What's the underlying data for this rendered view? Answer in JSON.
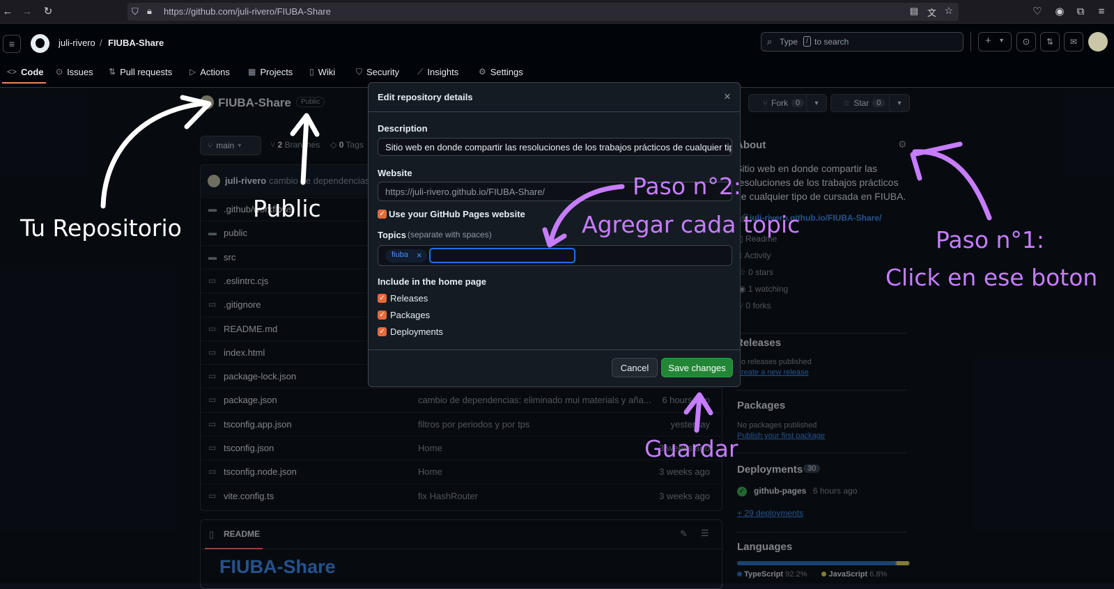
{
  "browser": {
    "url": "https://github.com/juli-rivero/FIUBA-Share"
  },
  "header": {
    "owner": "juli-rivero",
    "separator": "/",
    "repo": "FIUBA-Share",
    "search_placeholder_pre": "Type",
    "search_key": "/",
    "search_placeholder_post": "to search",
    "plus": "+"
  },
  "nav": {
    "tabs": [
      {
        "label": "Code",
        "icon": "code-icon"
      },
      {
        "label": "Issues",
        "icon": "issue-icon"
      },
      {
        "label": "Pull requests",
        "icon": "pull-request-icon"
      },
      {
        "label": "Actions",
        "icon": "play-icon"
      },
      {
        "label": "Projects",
        "icon": "table-icon"
      },
      {
        "label": "Wiki",
        "icon": "book-icon"
      },
      {
        "label": "Security",
        "icon": "shield-icon"
      },
      {
        "label": "Insights",
        "icon": "graph-icon"
      },
      {
        "label": "Settings",
        "icon": "gear-icon"
      }
    ]
  },
  "repo": {
    "name": "FIUBA-Share",
    "visibility": "Public",
    "branch": "main",
    "branches_count": "2",
    "branches_label": "Branches",
    "tags_count": "0",
    "tags_label": "Tags",
    "fork_label": "Fork",
    "fork_count": "0",
    "star_label": "Star",
    "star_count": "0",
    "commit_author": "juli-rivero",
    "commit_msg": "cambio de dependencias:"
  },
  "files": [
    {
      "name": ".github/workflows",
      "type": "dir",
      "msg": "",
      "time": ""
    },
    {
      "name": "public",
      "type": "dir",
      "msg": "",
      "time": ""
    },
    {
      "name": "src",
      "type": "dir",
      "msg": "",
      "time": ""
    },
    {
      "name": ".eslintrc.cjs",
      "type": "file",
      "msg": "",
      "time": ""
    },
    {
      "name": ".gitignore",
      "type": "file",
      "msg": "",
      "time": ""
    },
    {
      "name": "README.md",
      "type": "file",
      "msg": "",
      "time": ""
    },
    {
      "name": "index.html",
      "type": "file",
      "msg": "",
      "time": ""
    },
    {
      "name": "package-lock.json",
      "type": "file",
      "msg": "",
      "time": ""
    },
    {
      "name": "package.json",
      "type": "file",
      "msg": "cambio de dependencias: eliminado mui materials y aña...",
      "time": "6 hours ago"
    },
    {
      "name": "tsconfig.app.json",
      "type": "file",
      "msg": "filtros por periodos y por tps",
      "time": "yesterday"
    },
    {
      "name": "tsconfig.json",
      "type": "file",
      "msg": "Home",
      "time": "3 weeks ago"
    },
    {
      "name": "tsconfig.node.json",
      "type": "file",
      "msg": "Home",
      "time": "3 weeks ago"
    },
    {
      "name": "vite.config.ts",
      "type": "file",
      "msg": "fix HashRouter",
      "time": "3 weeks ago"
    }
  ],
  "readme": {
    "tab": "README",
    "title": "FIUBA-Share"
  },
  "about": {
    "heading": "About",
    "description": "Sitio web en donde compartir las resoluciones de los trabajos prácticos de cualquier tipo de cursada en FIUBA.",
    "website": "juli-rivero.github.io/FIUBA-Share/",
    "items": [
      "Readme",
      "Activity",
      "0 stars",
      "1 watching",
      "0 forks"
    ]
  },
  "releases": {
    "heading": "Releases",
    "none": "No releases published",
    "link": "Create a new release"
  },
  "packages": {
    "heading": "Packages",
    "none": "No packages published",
    "link": "Publish your first package"
  },
  "deployments": {
    "heading": "Deployments",
    "count": "30",
    "env": "github-pages",
    "time": "6 hours ago",
    "more": "+ 29 deployments"
  },
  "languages": {
    "heading": "Languages",
    "items": [
      {
        "name": "TypeScript",
        "pct": "92.2%",
        "value": 92.2,
        "color": "#3178c6"
      },
      {
        "name": "JavaScript",
        "pct": "6.8%",
        "value": 6.8,
        "color": "#f1e05a"
      }
    ]
  },
  "modal": {
    "title": "Edit repository details",
    "close": "×",
    "description_label": "Description",
    "description_value": "Sitio web en donde compartir las resoluciones de los trabajos prácticos de cualquier tipo",
    "website_label": "Website",
    "website_value": "https://juli-rivero.github.io/FIUBA-Share/",
    "use_pages_label": "Use your GitHub Pages website",
    "topics_label": "Topics",
    "topics_hint": "(separate with spaces)",
    "topic_chip": "fiuba",
    "topic_remove": "×",
    "include_label": "Include in the home page",
    "include_items": [
      "Releases",
      "Packages",
      "Deployments"
    ],
    "cancel": "Cancel",
    "save": "Save changes"
  },
  "annotations": {
    "tu_repositorio": "Tu Repositorio",
    "public": "Public",
    "paso2_title": "Paso n°2:",
    "paso2_text": "Agregar cada topic",
    "paso1_title": "Paso n°1:",
    "paso1_text": "Click en ese boton",
    "guardar": "Guardar",
    "white": "#ffffff",
    "purple": "#c77dff"
  }
}
